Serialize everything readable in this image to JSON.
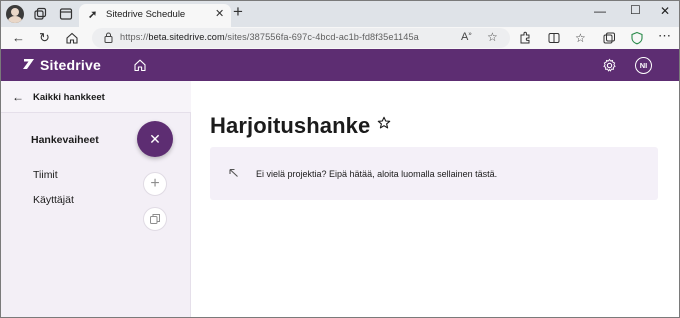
{
  "browser": {
    "tab_title": "Sitedrive Schedule",
    "url_prefix": "https://",
    "url_host": "beta.sitedrive.com",
    "url_path": "/sites/387556fa-697c-4bcd-ac1b-fd8f35e1145a"
  },
  "app": {
    "brand": "Sitedrive",
    "user_initials": "NI",
    "brand_color": "#5d2d72"
  },
  "sidebar": {
    "back_label": "Kaikki hankkeet",
    "section_title": "Hankevaiheet",
    "items": [
      {
        "label": "Tiimit"
      },
      {
        "label": "Käyttäjät"
      }
    ]
  },
  "main": {
    "project_title": "Harjoitushanke",
    "empty_notice": "Ei vielä projektia? Eipä hätää, aloita luomalla sellainen tästä."
  }
}
